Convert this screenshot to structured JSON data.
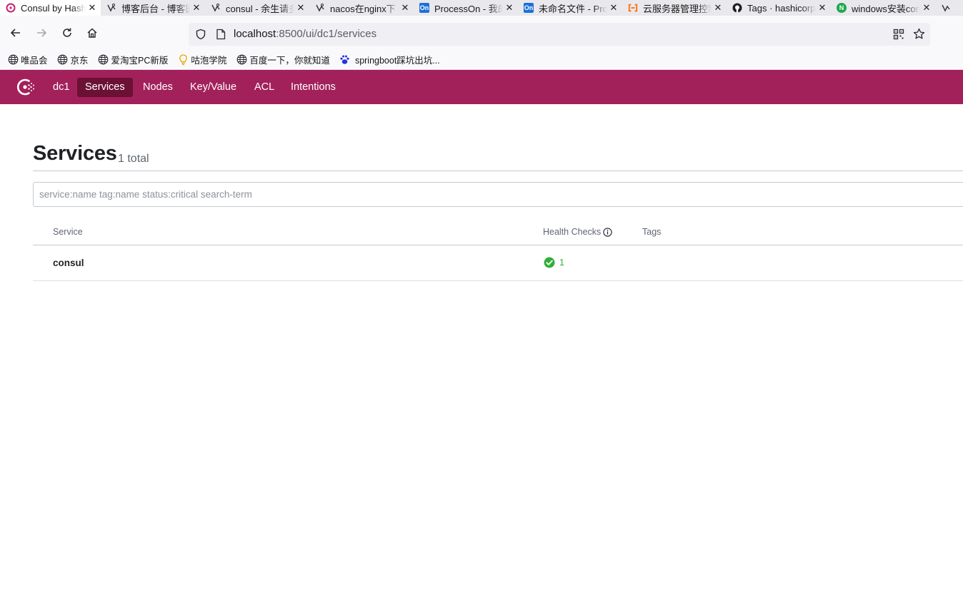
{
  "browser": {
    "tabs": [
      {
        "label": "Consul by HashiCorp",
        "icon": "consul-icon",
        "active": true
      },
      {
        "label": "博客后台 - 博客园",
        "icon": "cnblogs-icon"
      },
      {
        "label": "consul - 余生请多指教",
        "icon": "cnblogs-icon"
      },
      {
        "label": "nacos在nginx下",
        "icon": "cnblogs-icon"
      },
      {
        "label": "ProcessOn - 我的文件",
        "icon": "processon-icon"
      },
      {
        "label": "未命名文件 - ProcessOn",
        "icon": "processon-icon"
      },
      {
        "label": "云服务器管理控制台",
        "icon": "aliyun-icon"
      },
      {
        "label": "Tags · hashicorp/consul",
        "icon": "github-icon"
      },
      {
        "label": "windows安装consul",
        "icon": "n-icon"
      }
    ],
    "url_host": "localhost",
    "url_path": ":8500/ui/dc1/services",
    "bookmarks": [
      {
        "label": "唯品会",
        "icon": "globe-icon"
      },
      {
        "label": "京东",
        "icon": "globe-icon"
      },
      {
        "label": "爱淘宝PC新版",
        "icon": "globe-icon"
      },
      {
        "label": "咕泡学院",
        "icon": "bulb-icon"
      },
      {
        "label": "百度一下，你就知道",
        "icon": "globe-icon"
      },
      {
        "label": "springboot踩坑出坑...",
        "icon": "baidu-paw-icon"
      }
    ]
  },
  "header": {
    "datacenter": "dc1",
    "nav": [
      {
        "label": "Services",
        "active": true
      },
      {
        "label": "Nodes"
      },
      {
        "label": "Key/Value"
      },
      {
        "label": "ACL"
      },
      {
        "label": "Intentions"
      }
    ]
  },
  "page": {
    "title": "Services",
    "count_text": "1 total",
    "search_placeholder": "service:name tag:name status:critical search-term"
  },
  "table": {
    "columns": [
      "Service",
      "Health Checks",
      "Tags"
    ],
    "rows": [
      {
        "service": "consul",
        "health_passing": "1",
        "tags": ""
      }
    ]
  },
  "colors": {
    "brand": "#a2215b",
    "brand_active": "#6b1134",
    "passing": "#2eb039"
  }
}
